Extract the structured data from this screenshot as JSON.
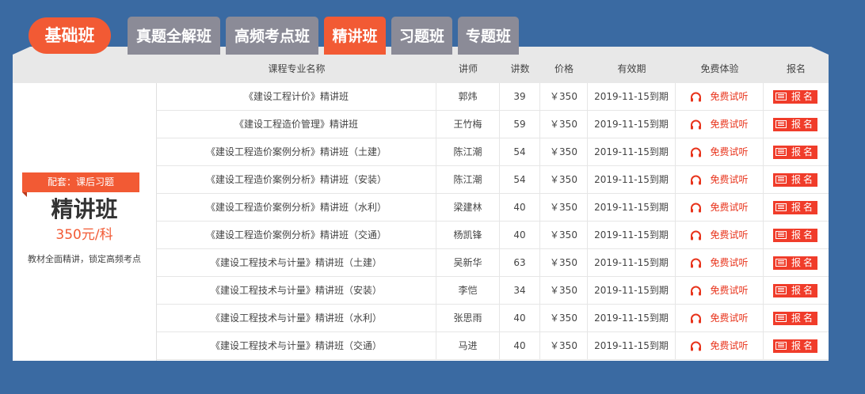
{
  "badge": "基础班",
  "tabs": [
    {
      "label": "真题全解班",
      "active": false
    },
    {
      "label": "高频考点班",
      "active": false
    },
    {
      "label": "精讲班",
      "active": true
    },
    {
      "label": "习题班",
      "active": false
    },
    {
      "label": "专题班",
      "active": false
    }
  ],
  "headers": {
    "name": "课程专业名称",
    "teacher": "讲师",
    "lessons": "讲数",
    "price": "价格",
    "validity": "有效期",
    "trial": "免费体验",
    "signup": "报名"
  },
  "course": {
    "tag": "配套：课后习题",
    "title": "精讲班",
    "price": "350元/科",
    "desc": "教材全面精讲，锁定高频考点"
  },
  "rows": [
    {
      "name": "《建设工程计价》精讲班",
      "teacher": "郭炜",
      "lessons": "39",
      "price": "￥350",
      "validity": "2019-11-15到期",
      "trial": "免费试听",
      "signup": "报名"
    },
    {
      "name": "《建设工程造价管理》精讲班",
      "teacher": "王竹梅",
      "lessons": "59",
      "price": "￥350",
      "validity": "2019-11-15到期",
      "trial": "免费试听",
      "signup": "报名"
    },
    {
      "name": "《建设工程造价案例分析》精讲班（土建）",
      "teacher": "陈江潮",
      "lessons": "54",
      "price": "￥350",
      "validity": "2019-11-15到期",
      "trial": "免费试听",
      "signup": "报名"
    },
    {
      "name": "《建设工程造价案例分析》精讲班（安装）",
      "teacher": "陈江潮",
      "lessons": "54",
      "price": "￥350",
      "validity": "2019-11-15到期",
      "trial": "免费试听",
      "signup": "报名"
    },
    {
      "name": "《建设工程造价案例分析》精讲班（水利）",
      "teacher": "梁建林",
      "lessons": "40",
      "price": "￥350",
      "validity": "2019-11-15到期",
      "trial": "免费试听",
      "signup": "报名"
    },
    {
      "name": "《建设工程造价案例分析》精讲班（交通）",
      "teacher": "杨凯锋",
      "lessons": "40",
      "price": "￥350",
      "validity": "2019-11-15到期",
      "trial": "免费试听",
      "signup": "报名"
    },
    {
      "name": "《建设工程技术与计量》精讲班（土建）",
      "teacher": "吴新华",
      "lessons": "63",
      "price": "￥350",
      "validity": "2019-11-15到期",
      "trial": "免费试听",
      "signup": "报名"
    },
    {
      "name": "《建设工程技术与计量》精讲班（安装）",
      "teacher": "李恺",
      "lessons": "34",
      "price": "￥350",
      "validity": "2019-11-15到期",
      "trial": "免费试听",
      "signup": "报名"
    },
    {
      "name": "《建设工程技术与计量》精讲班（水利）",
      "teacher": "张思雨",
      "lessons": "40",
      "price": "￥350",
      "validity": "2019-11-15到期",
      "trial": "免费试听",
      "signup": "报名"
    },
    {
      "name": "《建设工程技术与计量》精讲班（交通）",
      "teacher": "马进",
      "lessons": "40",
      "price": "￥350",
      "validity": "2019-11-15到期",
      "trial": "免费试听",
      "signup": "报名"
    }
  ],
  "colors": {
    "accent": "#f25a34",
    "background": "#3a6aa2",
    "tab_inactive": "#8b8b97"
  },
  "icons": {
    "trial": "headphones-icon",
    "signup": "register-icon"
  }
}
